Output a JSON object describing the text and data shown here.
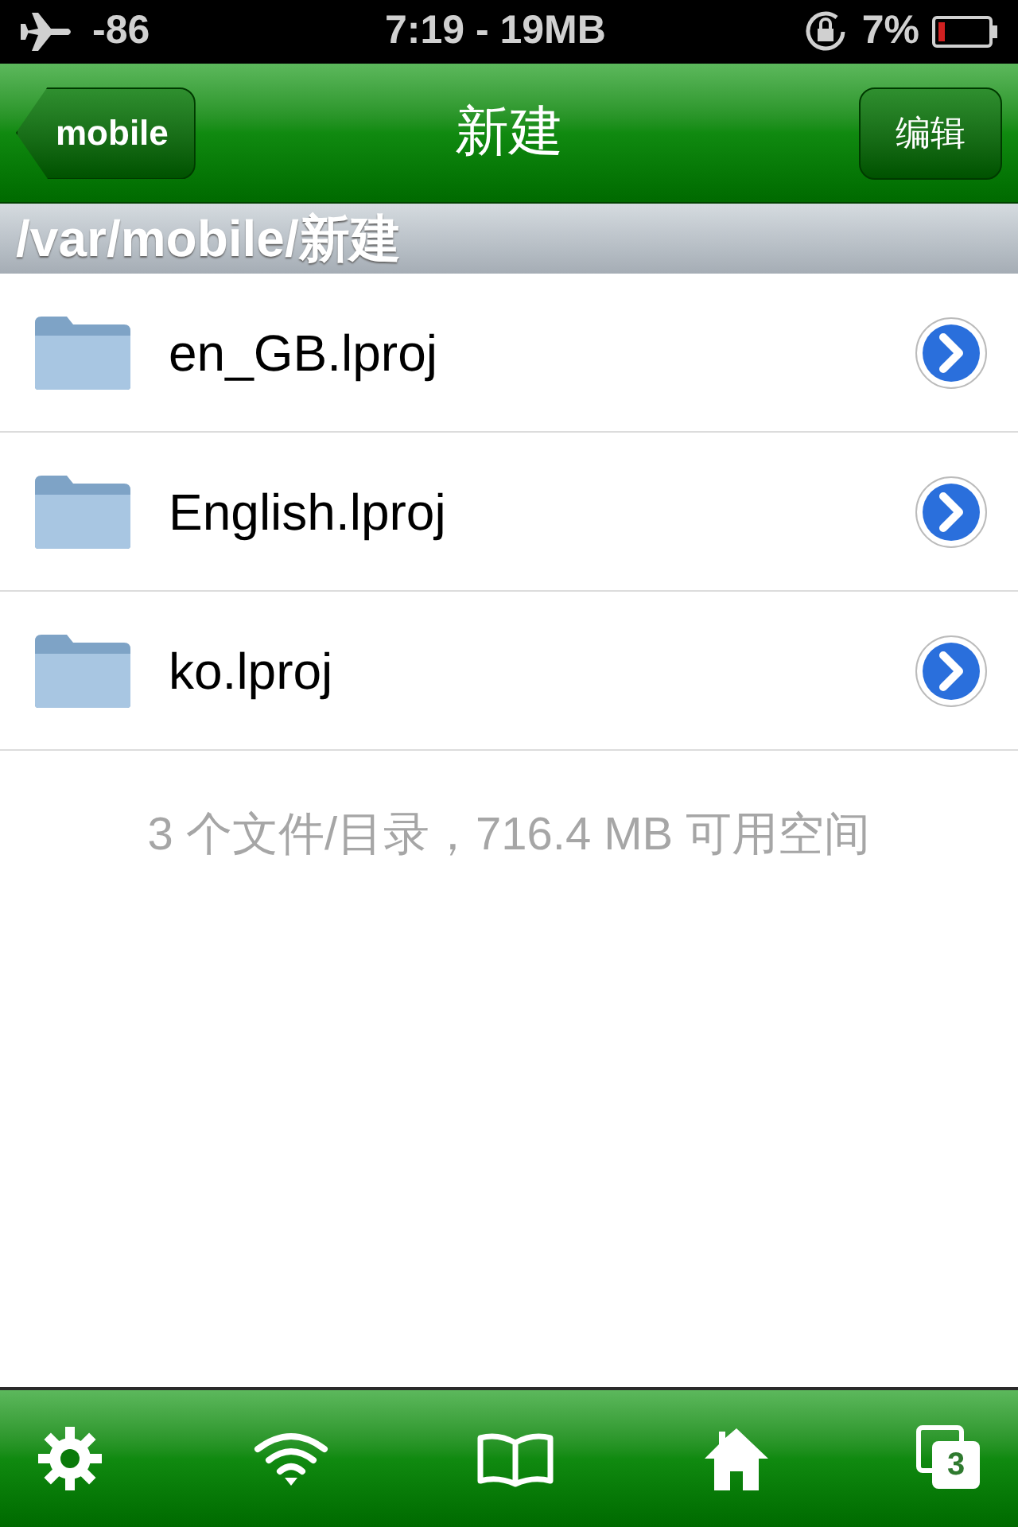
{
  "status_bar": {
    "signal": "-86",
    "time": "7:19 - 19MB",
    "battery": "7%"
  },
  "nav_bar": {
    "back": "mobile",
    "title": "新建",
    "edit": "编辑"
  },
  "path": "/var/mobile/新建",
  "files": [
    {
      "name": "en_GB.lproj",
      "kind": "folder"
    },
    {
      "name": "English.lproj",
      "kind": "folder"
    },
    {
      "name": "ko.lproj",
      "kind": "folder"
    }
  ],
  "summary": "3 个文件/目录，716.4 MB 可用空间",
  "tab_bar": [
    {
      "kind": "settings"
    },
    {
      "kind": "wifi"
    },
    {
      "kind": "bookmarks"
    },
    {
      "kind": "home"
    },
    {
      "kind": "windows",
      "count": "3"
    }
  ]
}
